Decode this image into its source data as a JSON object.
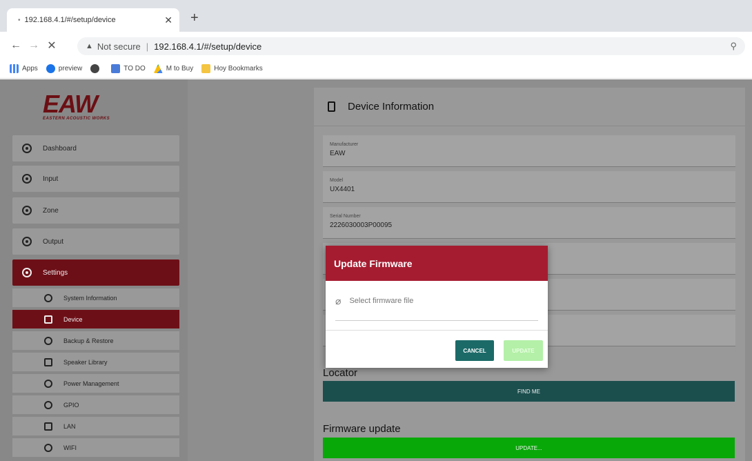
{
  "browser": {
    "tab_title": "192.168.4.1/#/setup/device",
    "new_tab": "+",
    "omnibox": {
      "security": "Not secure",
      "url": "192.168.4.1/#/setup/device"
    },
    "bookmarks": [
      {
        "label": "Apps",
        "color": "#4285f4"
      },
      {
        "label": "preview",
        "color": "#1a73e8"
      },
      {
        "label": "",
        "color": "#444444"
      },
      {
        "label": "TO DO",
        "color": "#4a7bd9"
      },
      {
        "label": "M to Buy",
        "color": "#34a853"
      },
      {
        "label": "Hoy Bookmarks",
        "color": "#f4c542"
      }
    ]
  },
  "logo": {
    "mark": "EAW",
    "tagline": "EASTERN ACOUSTIC WORKS"
  },
  "sidebar": {
    "items": [
      {
        "label": "Dashboard"
      },
      {
        "label": "Input"
      },
      {
        "label": "Zone"
      },
      {
        "label": "Output"
      },
      {
        "label": "Settings"
      }
    ],
    "sub_items": [
      {
        "label": "System Information"
      },
      {
        "label": "Device"
      },
      {
        "label": "Backup & Restore"
      },
      {
        "label": "Speaker Library"
      },
      {
        "label": "Power Management"
      },
      {
        "label": "GPIO"
      },
      {
        "label": "LAN"
      },
      {
        "label": "WIFI"
      }
    ]
  },
  "device": {
    "title": "Device Information",
    "fields": [
      {
        "label": "Manufacturer",
        "value": "EAW"
      },
      {
        "label": "Model",
        "value": "UX4401"
      },
      {
        "label": "Serial Number",
        "value": "2226030003P00095"
      }
    ],
    "locator_title": "Locator",
    "find_me_label": "FIND ME",
    "firmware_title": "Firmware update",
    "firmware_button_label": "UPDATE..."
  },
  "modal": {
    "title": "Update Firmware",
    "file_placeholder": "Select firmware file",
    "cancel_label": "CANCEL",
    "update_label": "UPDATE"
  },
  "colors": {
    "accent": "#a51c30",
    "active_menu": "#6d0f17",
    "teal": "#1b6a68",
    "update_green": "#00c800"
  }
}
